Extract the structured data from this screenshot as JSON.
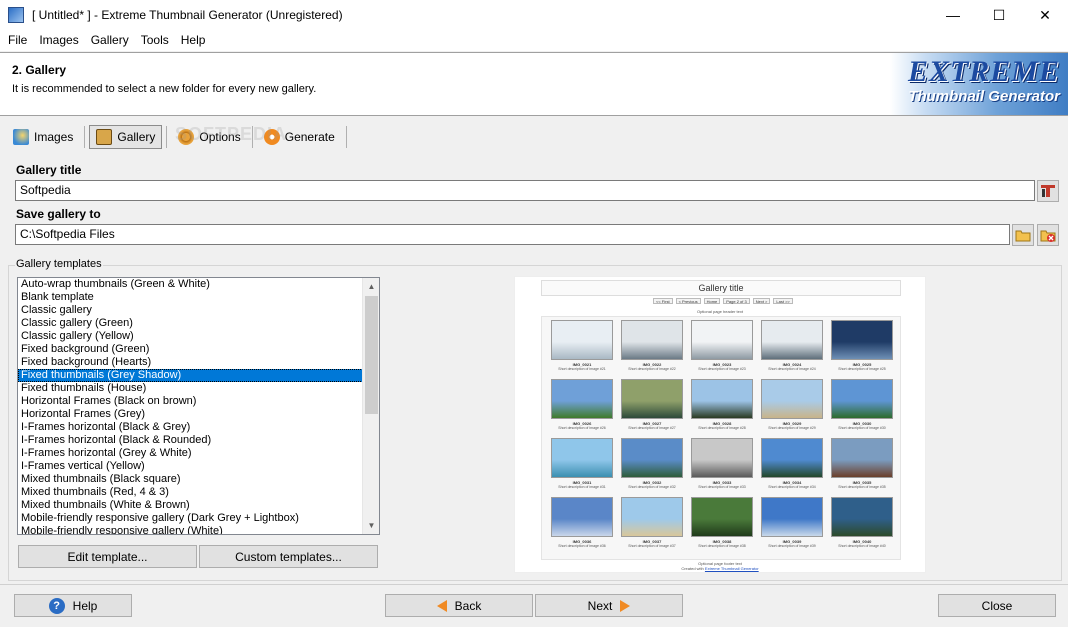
{
  "window": {
    "title": "[ Untitled* ] - Extreme Thumbnail Generator (Unregistered)",
    "minimize_glyph": "—",
    "maximize_glyph": "☐",
    "close_glyph": "✕"
  },
  "menu": [
    "File",
    "Images",
    "Gallery",
    "Tools",
    "Help"
  ],
  "header": {
    "step": "2. Gallery",
    "description": "It is recommended to select a new folder for every new gallery.",
    "logo_line1": "EXTREME",
    "logo_line2": "Thumbnail Generator"
  },
  "tabs": [
    {
      "label": "Images",
      "icon": "images-icon",
      "active": false
    },
    {
      "label": "Gallery",
      "icon": "gallery-icon",
      "active": true
    },
    {
      "label": "Options",
      "icon": "options-icon",
      "active": false
    },
    {
      "label": "Generate",
      "icon": "generate-icon",
      "active": false
    }
  ],
  "watermark": "SOFTPEDIA",
  "gallery_title": {
    "label": "Gallery title",
    "value": "Softpedia"
  },
  "save_gallery": {
    "label": "Save gallery to",
    "value": "C:\\Softpedia Files"
  },
  "templates": {
    "group_label": "Gallery templates",
    "items": [
      "Auto-wrap thumbnails (Green & White)",
      "Blank template",
      "Classic gallery",
      "Classic gallery (Green)",
      "Classic gallery (Yellow)",
      "Fixed background (Green)",
      "Fixed background (Hearts)",
      "Fixed thumbnails (Grey Shadow)",
      "Fixed thumbnails (House)",
      "Horizontal Frames (Black on brown)",
      "Horizontal Frames (Grey)",
      "I-Frames horizontal (Black & Grey)",
      "I-Frames horizontal (Black & Rounded)",
      "I-Frames horizontal (Grey & White)",
      "I-Frames vertical (Yellow)",
      "Mixed thumbnails (Black square)",
      "Mixed thumbnails (Red, 4 & 3)",
      "Mixed thumbnails (White & Brown)",
      "Mobile-friendly responsive gallery (Dark Grey + Lightbox)",
      "Mobile-friendly responsive gallery (White)"
    ],
    "selected_index": 7,
    "edit_button": "Edit template...",
    "custom_button": "Custom templates..."
  },
  "preview": {
    "title": "Gallery title",
    "nav": [
      "<< First",
      "< Previous",
      "Home",
      "Page 2 of 3",
      "Next >",
      "Last >>"
    ],
    "header_text": "Optional page header text",
    "thumbs": [
      {
        "name": "IMG_0021",
        "desc": "Short description of image #21"
      },
      {
        "name": "IMG_0022",
        "desc": "Short description of image #22"
      },
      {
        "name": "IMG_0023",
        "desc": "Short description of image #23"
      },
      {
        "name": "IMG_0024",
        "desc": "Short description of image #24"
      },
      {
        "name": "IMG_0025",
        "desc": "Short description of image #25"
      },
      {
        "name": "IMG_0026",
        "desc": "Short description of image #26"
      },
      {
        "name": "IMG_0027",
        "desc": "Short description of image #27"
      },
      {
        "name": "IMG_0028",
        "desc": "Short description of image #28"
      },
      {
        "name": "IMG_0029",
        "desc": "Short description of image #29"
      },
      {
        "name": "IMG_0030",
        "desc": "Short description of image #30"
      },
      {
        "name": "IMG_0031",
        "desc": "Short description of image #31"
      },
      {
        "name": "IMG_0032",
        "desc": "Short description of image #32"
      },
      {
        "name": "IMG_0033",
        "desc": "Short description of image #33"
      },
      {
        "name": "IMG_0034",
        "desc": "Short description of image #34"
      },
      {
        "name": "IMG_0035",
        "desc": "Short description of image #35"
      },
      {
        "name": "IMG_0036",
        "desc": "Short description of image #36"
      },
      {
        "name": "IMG_0037",
        "desc": "Short description of image #37"
      },
      {
        "name": "IMG_0038",
        "desc": "Short description of image #38"
      },
      {
        "name": "IMG_0039",
        "desc": "Short description of image #39"
      },
      {
        "name": "IMG_0040",
        "desc": "Short description of image #40"
      }
    ],
    "footer_text": "Optional page footer text",
    "created_with": "Created with",
    "created_link": "Extreme Thumbnail Generator"
  },
  "buttons": {
    "help": "Help",
    "back": "Back",
    "next": "Next",
    "close": "Close"
  },
  "colors": {
    "selection": "#0078d7",
    "accent_arrow": "#f08a24",
    "logo_blue": "#1c4aa0"
  }
}
